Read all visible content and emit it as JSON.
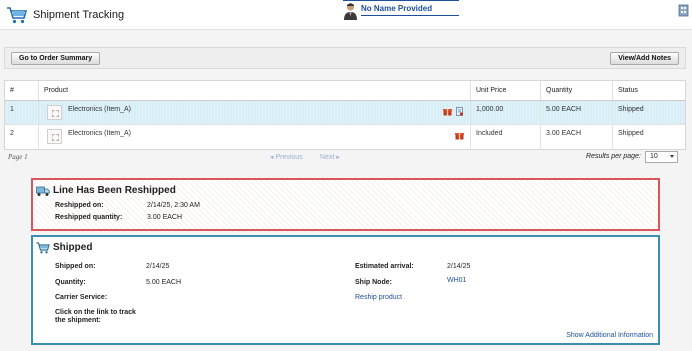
{
  "header": {
    "title": "Shipment Tracking",
    "user_name": "No Name Provided"
  },
  "toolbar": {
    "order_summary_label": "Go to Order Summary",
    "notes_label": "View/Add Notes"
  },
  "grid": {
    "columns": [
      "#",
      "Product",
      "Unit Price",
      "Quantity",
      "Status"
    ],
    "rows": [
      {
        "num": "1",
        "product": "Electronics (Item_A)",
        "unit_price": "1,000.00",
        "quantity": "5.00 EACH",
        "status": "Shipped",
        "selected": true
      },
      {
        "num": "2",
        "product": "Electronics (Item_A)",
        "unit_price": "Included",
        "quantity": "3.00 EACH",
        "status": "Shipped",
        "selected": false
      }
    ]
  },
  "pager": {
    "page_label": "Page 1",
    "prev_label": "Previous",
    "next_label": "Next",
    "rpp_label": "Results per page:",
    "rpp_value": "10"
  },
  "reshipped": {
    "title": "Line Has Been Reshipped",
    "reshipped_on_label": "Reshipped on:",
    "reshipped_on_value": "2/14/25, 2:30 AM",
    "quantity_label": "Reshipped quantity:",
    "quantity_value": "3.00 EACH"
  },
  "shipped": {
    "title": "Shipped",
    "shipped_on_label": "Shipped on:",
    "shipped_on_value": "2/14/25",
    "quantity_label": "Quantity:",
    "quantity_value": "5.00 EACH",
    "carrier_label": "Carrier Service:",
    "track_label": "Click on the link to track the shipment:",
    "estimated_label": "Estimated arrival:",
    "estimated_value": "2/14/25",
    "ship_node_label": "Ship Node:",
    "ship_node_value": "WH01",
    "reship_link": "Reship product",
    "additional_link": "Show Additional Information"
  },
  "colors": {
    "accent": "#1e4f9c",
    "reship_border": "#d9565c",
    "shipped_border": "#3a8fb0",
    "selected_row": "#d7eef7"
  },
  "icons": {
    "logo": "shopping-cart-icon",
    "user": "user-avatar-icon",
    "reship": "truck-icon",
    "shipped": "cart-icon",
    "row": "gift-box-icon"
  }
}
